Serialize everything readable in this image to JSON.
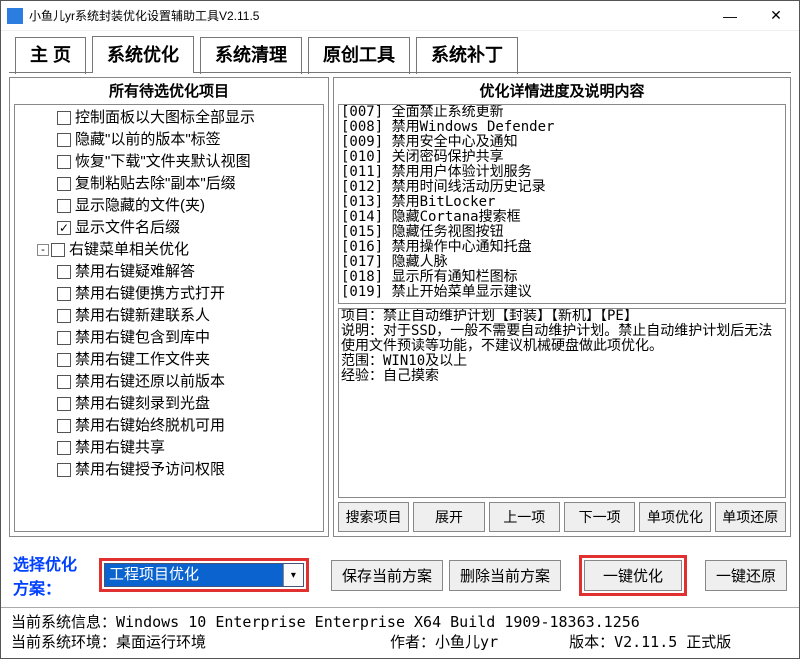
{
  "window": {
    "title": "小鱼儿yr系统封装优化设置辅助工具V2.11.5"
  },
  "tabs": [
    "主 页",
    "系统优化",
    "系统清理",
    "原创工具",
    "系统补丁"
  ],
  "activeTab": 1,
  "leftHeader": "所有待选优化项目",
  "rightHeader": "优化详情进度及说明内容",
  "tree": [
    {
      "indent": 1,
      "checked": false,
      "label": "控制面板以大图标全部显示"
    },
    {
      "indent": 1,
      "checked": false,
      "label": "隐藏\"以前的版本\"标签"
    },
    {
      "indent": 1,
      "checked": false,
      "label": "恢复\"下载\"文件夹默认视图"
    },
    {
      "indent": 1,
      "checked": false,
      "label": "复制粘贴去除\"副本\"后缀"
    },
    {
      "indent": 1,
      "checked": false,
      "label": "显示隐藏的文件(夹)"
    },
    {
      "indent": 1,
      "checked": true,
      "label": "显示文件名后缀"
    },
    {
      "indent": 0,
      "expander": "-",
      "checked": false,
      "label": "右键菜单相关优化"
    },
    {
      "indent": 1,
      "checked": false,
      "label": "禁用右键疑难解答"
    },
    {
      "indent": 1,
      "checked": false,
      "label": "禁用右键便携方式打开"
    },
    {
      "indent": 1,
      "checked": false,
      "label": "禁用右键新建联系人"
    },
    {
      "indent": 1,
      "checked": false,
      "label": "禁用右键包含到库中"
    },
    {
      "indent": 1,
      "checked": false,
      "label": "禁用右键工作文件夹"
    },
    {
      "indent": 1,
      "checked": false,
      "label": "禁用右键还原以前版本"
    },
    {
      "indent": 1,
      "checked": false,
      "label": "禁用右键刻录到光盘"
    },
    {
      "indent": 1,
      "checked": false,
      "label": "禁用右键始终脱机可用"
    },
    {
      "indent": 1,
      "checked": false,
      "label": "禁用右键共享"
    },
    {
      "indent": 1,
      "checked": false,
      "label": "禁用右键授予访问权限"
    }
  ],
  "detailTop": [
    "[007] 全面禁止系统更新",
    "[008] 禁用Windows Defender",
    "[009] 禁用安全中心及通知",
    "[010] 关闭密码保护共享",
    "[011] 禁用用户体验计划服务",
    "[012] 禁用时间线活动历史记录",
    "[013] 禁用BitLocker",
    "[014] 隐藏Cortana搜索框",
    "[015] 隐藏任务视图按钮",
    "[016] 禁用操作中心通知托盘",
    "[017] 隐藏人脉",
    "[018] 显示所有通知栏图标",
    "[019] 禁止开始菜单显示建议"
  ],
  "detailBottom": [
    "项目：禁止自动维护计划【封装】【新机】【PE】",
    "说明：对于SSD，一般不需要自动维护计划。禁止自动维护计划后无法使用文件预读等功能，不建议机械硬盘做此项优化。",
    "范围：WIN10及以上",
    "经验：自己摸索"
  ],
  "detailButtons": [
    "搜索项目",
    "展开",
    "上一项",
    "下一项",
    "单项优化",
    "单项还原"
  ],
  "scheme": {
    "label": "选择优化方案：",
    "value": "工程项目优化",
    "buttons": [
      "保存当前方案",
      "删除当前方案",
      "一键优化",
      "一键还原"
    ]
  },
  "status": {
    "line1_a": "当前系统信息：Windows 10 Enterprise Enterprise X64 Build 1909-18363.1256",
    "line2_a": "当前系统环境：桌面运行环境",
    "line2_b": "作者：小鱼儿yr",
    "line2_c": "版本：V2.11.5 正式版"
  }
}
